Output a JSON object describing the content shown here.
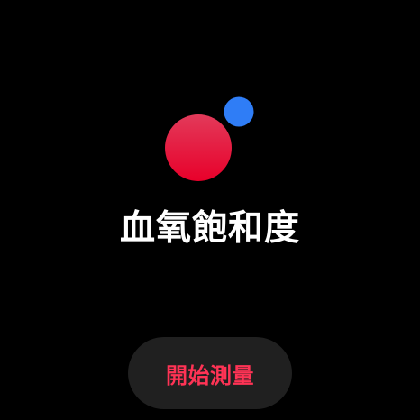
{
  "icon": {
    "name": "blood-oxygen-icon",
    "large_dot_color_top": "#e23a5a",
    "large_dot_color_bottom": "#e8002a",
    "small_dot_color": "#2f7df6"
  },
  "title": "血氧飽和度",
  "start_button": {
    "label": "開始測量",
    "label_color": "#ff3355"
  }
}
